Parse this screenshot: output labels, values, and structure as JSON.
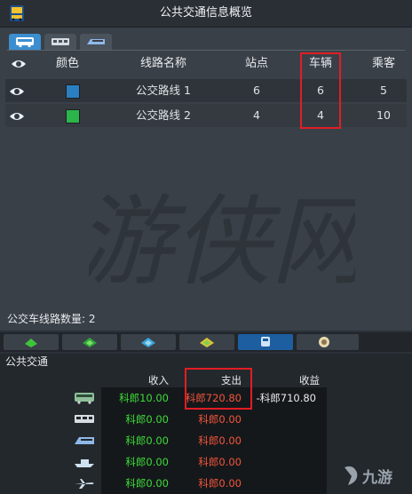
{
  "window": {
    "title": "公共交通信息概览"
  },
  "table": {
    "headers": {
      "color": "颜色",
      "name": "线路名称",
      "stops": "站点",
      "vehicles": "车辆",
      "passengers": "乘客"
    },
    "rows": [
      {
        "color": "#2a7fc0",
        "name": "公交路线 1",
        "stops": "6",
        "vehicles": "6",
        "passengers": "5"
      },
      {
        "color": "#2bb54a",
        "name": "公交路线 2",
        "stops": "4",
        "vehicles": "4",
        "passengers": "10"
      }
    ]
  },
  "line_count": "公交车线路数量: 2",
  "watermark": {
    "text": "游侠网"
  },
  "bottom": {
    "title": "公共交通",
    "headers": {
      "income": "收入",
      "expense": "支出",
      "profit": "收益"
    },
    "rows": [
      {
        "icon": "bus-icon",
        "income": "科郎10.00",
        "expense": "科郎720.80",
        "profit": "-科郎710.80"
      },
      {
        "icon": "tram-icon",
        "income": "科郎0.00",
        "expense": "科郎0.00",
        "profit": ""
      },
      {
        "icon": "train-icon",
        "income": "科郎0.00",
        "expense": "科郎0.00",
        "profit": ""
      },
      {
        "icon": "ship-icon",
        "income": "科郎0.00",
        "expense": "科郎0.00",
        "profit": ""
      },
      {
        "icon": "plane-icon",
        "income": "科郎0.00",
        "expense": "科郎0.00",
        "profit": ""
      }
    ]
  },
  "logo": {
    "text": "九游"
  },
  "colors": {
    "accent": "#3b8fd0",
    "income": "#3ddc39",
    "expense": "#f2553a",
    "highlight": "#e21d24"
  }
}
